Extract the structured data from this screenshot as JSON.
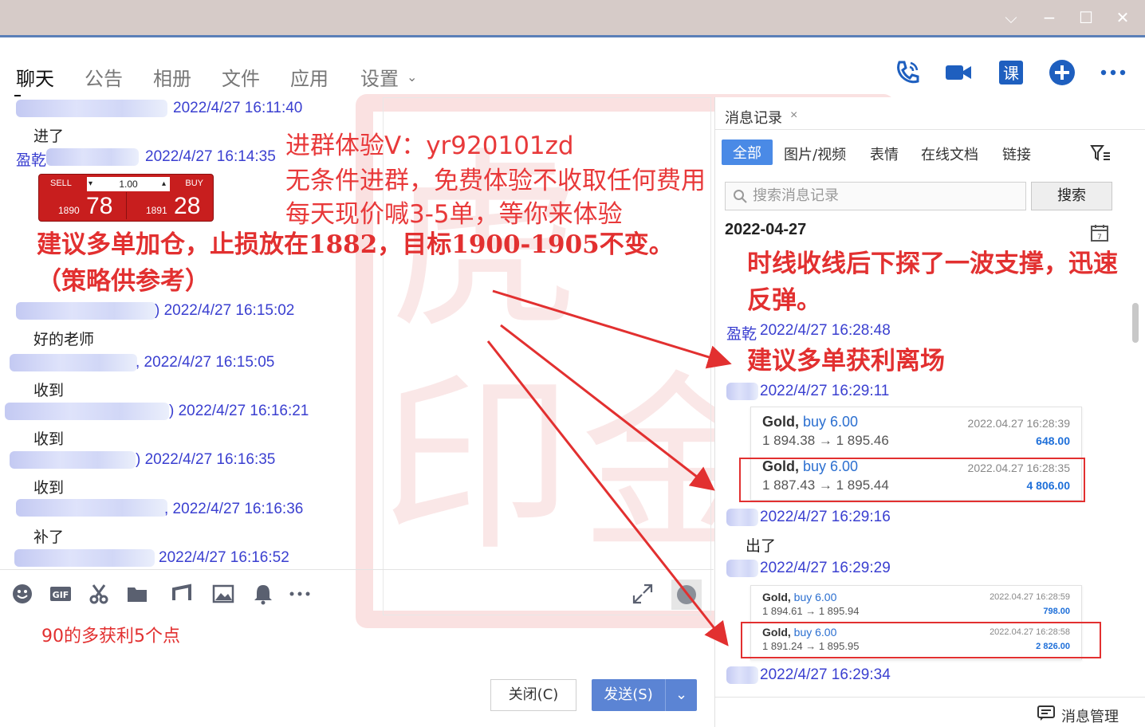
{
  "window": {
    "controls": [
      "chevron-down",
      "minimize",
      "maximize",
      "close"
    ]
  },
  "nav": {
    "tabs": [
      "聊天",
      "公告",
      "相册",
      "文件",
      "应用",
      "设置"
    ],
    "active": "聊天"
  },
  "chat": {
    "messages": [
      {
        "head": "2022/4/27 16:11:40",
        "body": "进了"
      },
      {
        "head": "盈乾",
        "time": "2022/4/27 16:14:35"
      },
      {
        "head": ") 2022/4/27 16:15:02",
        "body": "好的老师"
      },
      {
        "head": ", 2022/4/27 16:15:05",
        "body": "收到"
      },
      {
        "head": ") 2022/4/27 16:16:21",
        "body": "收到"
      },
      {
        "head": ") 2022/4/27 16:16:35",
        "body": "收到"
      },
      {
        "head": ", 2022/4/27 16:16:36",
        "body": "补了"
      },
      {
        "head": "2022/4/27 16:16:52"
      }
    ],
    "trade_widget": {
      "sell_label": "SELL",
      "buy_label": "BUY",
      "qty": "1.00",
      "sell_big": "1890",
      "sell_px": "78",
      "buy_big": "1891",
      "buy_px": "28"
    },
    "advice": "建议多单加仓，止损放在1882，目标1900-1905不变。（策略供参考）",
    "promo": [
      "进群体验V：yr920101zd",
      "无条件进群，免费体验不收取任何费用",
      "每天现价喊3-5单，等你来体验"
    ]
  },
  "input": {
    "text": "90的多获利5个点",
    "close_label": "关闭(C)",
    "send_label": "发送(S)"
  },
  "history": {
    "title": "消息记录",
    "tabs": [
      "全部",
      "图片/视频",
      "表情",
      "在线文档",
      "链接"
    ],
    "search_placeholder": "搜索消息记录",
    "search_button": "搜索",
    "date": "2022-04-27",
    "note1": "时线收线后下探了一波支撑，迅速反弹。",
    "author": "盈乾",
    "time1": "2022/4/27 16:28:48",
    "advice": "建议多单获利离场",
    "time2": "2022/4/27 16:29:11",
    "orders1": [
      {
        "sym": "Gold,",
        "side": "buy 6.00",
        "move": "1 894.38 → 1 895.46",
        "time": "2022.04.27 16:28:39",
        "pl": "648.00"
      },
      {
        "sym": "Gold,",
        "side": "buy 6.00",
        "move": "1 887.43 → 1 895.44",
        "time": "2022.04.27 16:28:35",
        "pl": "4 806.00"
      }
    ],
    "time3": "2022/4/27 16:29:16",
    "body3": "出了",
    "time4": "2022/4/27 16:29:29",
    "orders2": [
      {
        "sym": "Gold,",
        "side": "buy 6.00",
        "move": "1 894.61 → 1 895.94",
        "time": "2022.04.27 16:28:59",
        "pl": "798.00"
      },
      {
        "sym": "Gold,",
        "side": "buy 6.00",
        "move": "1 891.24 → 1 895.95",
        "time": "2022.04.27 16:28:58",
        "pl": "2 826.00"
      }
    ],
    "time5": "2022/4/27 16:29:34",
    "footer": "消息管理"
  },
  "watermark": {
    "chars": [
      "虎",
      "印",
      "金"
    ]
  },
  "colors": {
    "accent": "#4a8ae6",
    "promo_red": "#e8393a",
    "name_blue": "#3a3fd0"
  }
}
